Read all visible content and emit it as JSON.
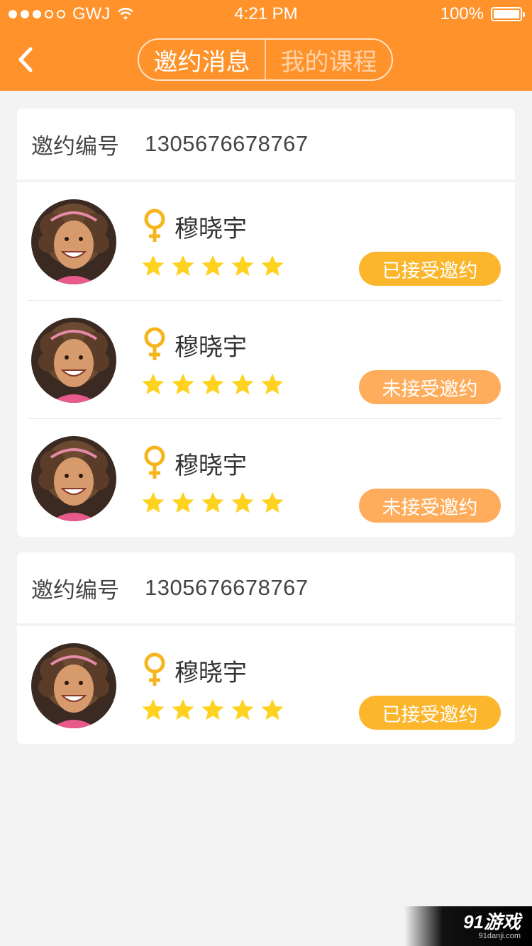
{
  "status_bar": {
    "carrier": "GWJ",
    "time": "4:21 PM",
    "battery": "100%",
    "signal_dots": [
      true,
      true,
      true,
      false,
      false
    ]
  },
  "nav": {
    "tabs": [
      {
        "label": "邀约消息",
        "active": true
      },
      {
        "label": "我的课程",
        "active": false
      }
    ]
  },
  "colors": {
    "brand": "#ff922b",
    "accepted": "#fbb62c",
    "not_accepted": "#ffad5c",
    "star": "#ffd21f",
    "gender": "#f7b51d"
  },
  "invitations": [
    {
      "id_label": "邀约编号",
      "id_value": "1305676678767",
      "people": [
        {
          "name": "穆晓宇",
          "gender_icon": "female-icon",
          "rating": 5,
          "status": "已接受邀约",
          "status_type": "accepted"
        },
        {
          "name": "穆晓宇",
          "gender_icon": "female-icon",
          "rating": 5,
          "status": "未接受邀约",
          "status_type": "not_accepted"
        },
        {
          "name": "穆晓宇",
          "gender_icon": "female-icon",
          "rating": 5,
          "status": "未接受邀约",
          "status_type": "not_accepted"
        }
      ]
    },
    {
      "id_label": "邀约编号",
      "id_value": "1305676678767",
      "people": [
        {
          "name": "穆晓宇",
          "gender_icon": "female-icon",
          "rating": 5,
          "status": "已接受邀约",
          "status_type": "accepted"
        }
      ]
    }
  ],
  "watermark": {
    "logo_text": "91游戏",
    "url": "91danji.com"
  }
}
